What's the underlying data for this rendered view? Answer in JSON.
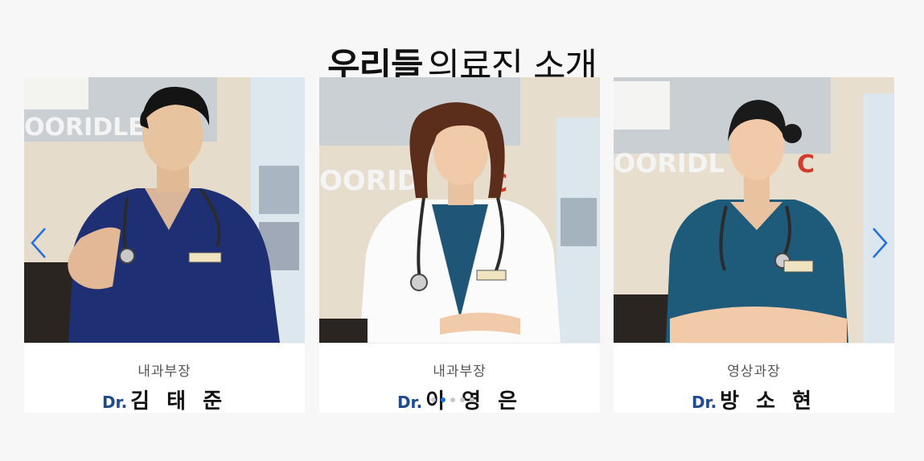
{
  "heading": {
    "bold": "우리들",
    "light": "의료진 소개"
  },
  "doctors": [
    {
      "title": "내과부장",
      "prefix": "Dr.",
      "name": "김 태 준",
      "scrub_color": "#1e2f73",
      "coat": false,
      "hair_color": "#141414",
      "sign_text": "OORIDLE"
    },
    {
      "title": "내과부장",
      "prefix": "Dr.",
      "name": "이 영 은",
      "scrub_color": "#1f5577",
      "coat": true,
      "hair_color": "#5a2e1b",
      "sign_text": "OORID"
    },
    {
      "title": "영상과장",
      "prefix": "Dr.",
      "name": "방 소 현",
      "scrub_color": "#1e5a7a",
      "coat": false,
      "hair_color": "#1a1a1a",
      "sign_text": "OORIDL"
    }
  ],
  "carousel": {
    "prev_icon": "chevron-left-icon",
    "next_icon": "chevron-right-icon",
    "dot_count": 5,
    "active_dot": 2,
    "accent_color": "#1f6fe0"
  }
}
